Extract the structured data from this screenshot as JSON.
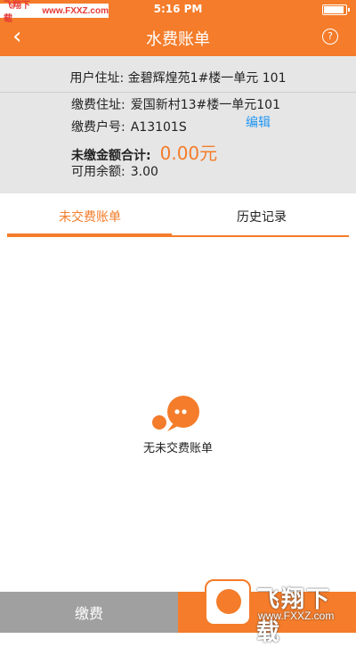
{
  "status_bar": {
    "time": "5:16 PM",
    "battery_level": 0.9,
    "watermark_text": "飞翔下载",
    "watermark_url": "www.FXXZ.com"
  },
  "header": {
    "title": "水费账单",
    "back_icon": "chevron-left-icon",
    "help_icon": "question-circle-icon",
    "help_glyph": "?"
  },
  "account": {
    "user_address_label": "用户住址:",
    "user_address": "金碧辉煌苑1#楼一单元 101",
    "pay_address_label": "缴费住址:",
    "pay_address": "爱国新村13#楼一单元101",
    "account_label": "缴费户号:",
    "account_no": "A13101S",
    "edit_label": "编辑",
    "unpaid_label": "未缴金额合计:",
    "unpaid_amount": "0.00元",
    "balance_label": "可用余额:",
    "balance": "3.00"
  },
  "tabs": [
    {
      "label": "未交费账单",
      "active": true
    },
    {
      "label": "历史记录",
      "active": false
    }
  ],
  "empty_state": {
    "icon": "chat-bubbles-icon",
    "text": "无未交费账单"
  },
  "bottom_bar": {
    "pay_label": "缴费"
  },
  "watermark_logo": {
    "name": "飞翔下载",
    "site": "www.FXXZ.com"
  },
  "colors": {
    "accent": "#F47C2A",
    "link": "#2196F3",
    "panel_bg": "#E6E6E6",
    "disabled_button": "#A0A0A0"
  }
}
